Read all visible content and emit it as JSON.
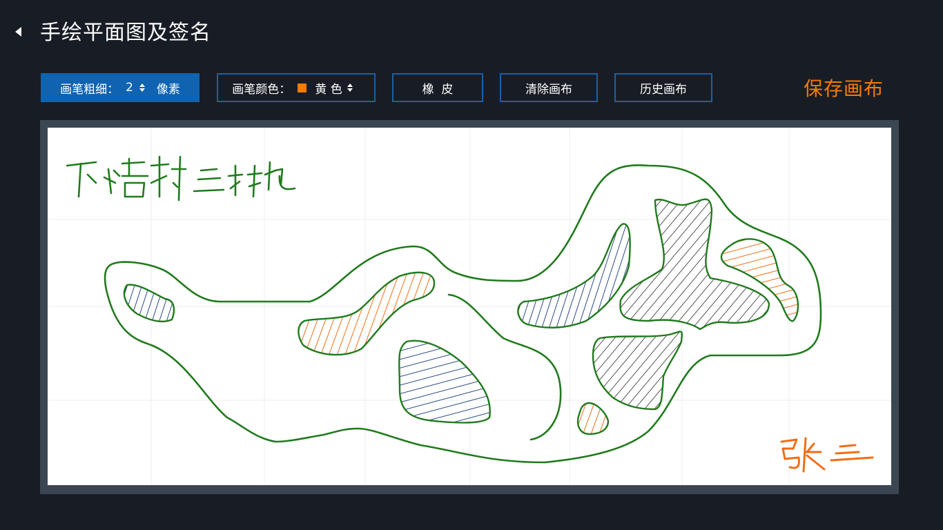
{
  "header": {
    "title": "手绘平面图及签名",
    "back_icon": "caret-left-icon"
  },
  "toolbar": {
    "brush_size": {
      "label": "画笔粗细：",
      "value": "2",
      "unit": "像素"
    },
    "brush_color": {
      "label": "画笔颜色：",
      "value": "黄 色",
      "swatch_color": "#f57c00"
    },
    "eraser_label": "橡  皮",
    "clear_label": "清除画布",
    "history_label": "历史画布",
    "save_label": "保存画布"
  },
  "canvas": {
    "handwritten_location": "下塘村 三林地",
    "handwritten_signature": "张三"
  },
  "colors": {
    "background": "#181d25",
    "accent_blue": "#0f63b0",
    "accent_orange": "#f57c00",
    "ink_green": "#207a1c",
    "ink_orange": "#f26d15",
    "ink_blue": "#2c4a87",
    "ink_black": "#2a2a2a"
  }
}
